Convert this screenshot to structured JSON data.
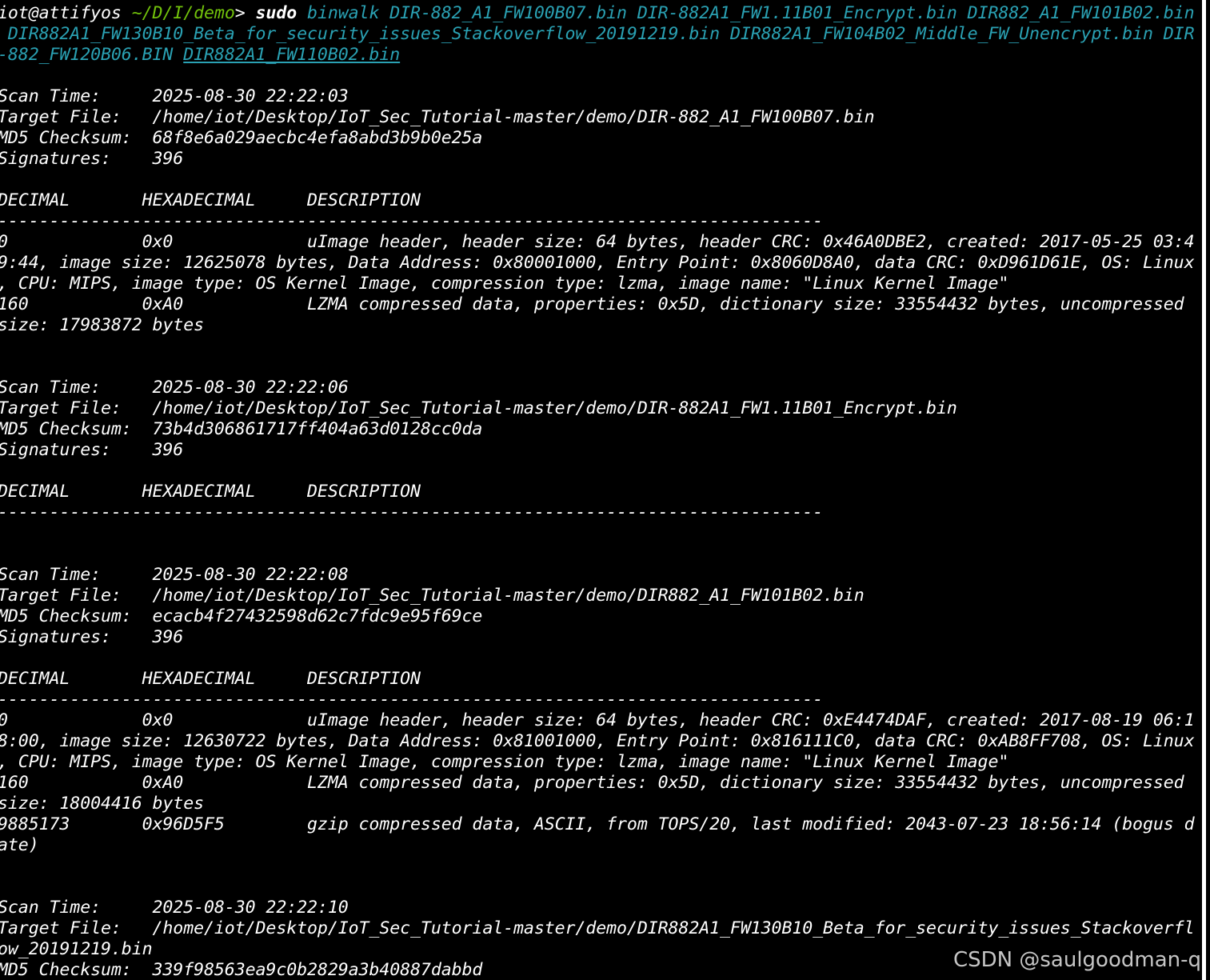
{
  "terminal": {
    "prompt": {
      "user_host": "iot@attifyos",
      "path": " ~/D/I/demo",
      "symbol": "> ",
      "sudo": "sudo",
      "cmd_line1": " binwalk DIR-882_A1_FW100B07.bin DIR-882A1_FW1.11B01_Encrypt.bin DIR882_A1_FW101B02.bin",
      "cmd_line2": " DIR882A1_FW130B10_Beta_for_security_issues_Stackoverflow_20191219.bin DIR882A1_FW104B02_Middle_FW_Unencrypt.bin DIR",
      "cmd_line3": "-882_FW120B06.BIN ",
      "cmd_line3_ul": "DIR882A1_FW110B02.bin"
    },
    "lines": [
      "",
      "Scan Time:     2025-08-30 22:22:03",
      "Target File:   /home/iot/Desktop/IoT_Sec_Tutorial-master/demo/DIR-882_A1_FW100B07.bin",
      "MD5 Checksum:  68f8e6a029aecbc4efa8abd3b9b0e25a",
      "Signatures:    396",
      "",
      "DECIMAL       HEXADECIMAL     DESCRIPTION",
      "--------------------------------------------------------------------------------",
      "0             0x0             uImage header, header size: 64 bytes, header CRC: 0x46A0DBE2, created: 2017-05-25 03:4",
      "9:44, image size: 12625078 bytes, Data Address: 0x80001000, Entry Point: 0x8060D8A0, data CRC: 0xD961D61E, OS: Linux",
      ", CPU: MIPS, image type: OS Kernel Image, compression type: lzma, image name: \"Linux Kernel Image\"",
      "160           0xA0            LZMA compressed data, properties: 0x5D, dictionary size: 33554432 bytes, uncompressed",
      "size: 17983872 bytes",
      "",
      "",
      "Scan Time:     2025-08-30 22:22:06",
      "Target File:   /home/iot/Desktop/IoT_Sec_Tutorial-master/demo/DIR-882A1_FW1.11B01_Encrypt.bin",
      "MD5 Checksum:  73b4d306861717ff404a63d0128cc0da",
      "Signatures:    396",
      "",
      "DECIMAL       HEXADECIMAL     DESCRIPTION",
      "--------------------------------------------------------------------------------",
      "",
      "",
      "Scan Time:     2025-08-30 22:22:08",
      "Target File:   /home/iot/Desktop/IoT_Sec_Tutorial-master/demo/DIR882_A1_FW101B02.bin",
      "MD5 Checksum:  ecacb4f27432598d62c7fdc9e95f69ce",
      "Signatures:    396",
      "",
      "DECIMAL       HEXADECIMAL     DESCRIPTION",
      "--------------------------------------------------------------------------------",
      "0             0x0             uImage header, header size: 64 bytes, header CRC: 0xE4474DAF, created: 2017-08-19 06:1",
      "8:00, image size: 12630722 bytes, Data Address: 0x81001000, Entry Point: 0x816111C0, data CRC: 0xAB8FF708, OS: Linux",
      ", CPU: MIPS, image type: OS Kernel Image, compression type: lzma, image name: \"Linux Kernel Image\"",
      "160           0xA0            LZMA compressed data, properties: 0x5D, dictionary size: 33554432 bytes, uncompressed",
      "size: 18004416 bytes",
      "9885173       0x96D5F5        gzip compressed data, ASCII, from TOPS/20, last modified: 2043-07-23 18:56:14 (bogus d",
      "ate)",
      "",
      "",
      "Scan Time:     2025-08-30 22:22:10",
      "Target File:   /home/iot/Desktop/IoT_Sec_Tutorial-master/demo/DIR882A1_FW130B10_Beta_for_security_issues_Stackoverfl",
      "ow_20191219.bin",
      "MD5 Checksum:  339f98563ea9c0b2829a3b40887dabbd"
    ]
  },
  "watermark": "CSDN @saulgoodman-q",
  "colors": {
    "background": "#000000",
    "text": "#ffffff",
    "path": "#72c20b",
    "argument": "#2aa1b3"
  }
}
